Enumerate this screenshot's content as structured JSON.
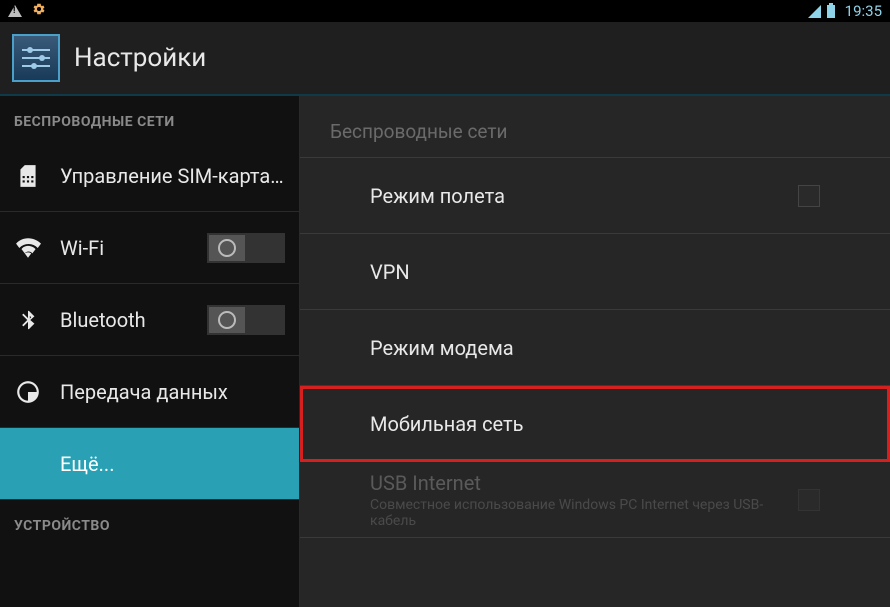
{
  "statusbar": {
    "time": "19:35"
  },
  "header": {
    "title": "Настройки"
  },
  "sidebar": {
    "section_wireless": "БЕСПРОВОДНЫЕ СЕТИ",
    "section_device": "УСТРОЙСТВО",
    "items": {
      "sim": "Управление SIM-картами",
      "wifi": "Wi-Fi",
      "bluetooth": "Bluetooth",
      "data_usage": "Передача данных",
      "more": "Ещё..."
    }
  },
  "content": {
    "header": "Беспроводные сети",
    "airplane": "Режим полета",
    "vpn": "VPN",
    "tethering": "Режим модема",
    "mobile_network": "Мобильная сеть",
    "usb_internet": {
      "label": "USB Internet",
      "sublabel": "Совместное использование Windows PC Internet через USB-кабель"
    }
  }
}
